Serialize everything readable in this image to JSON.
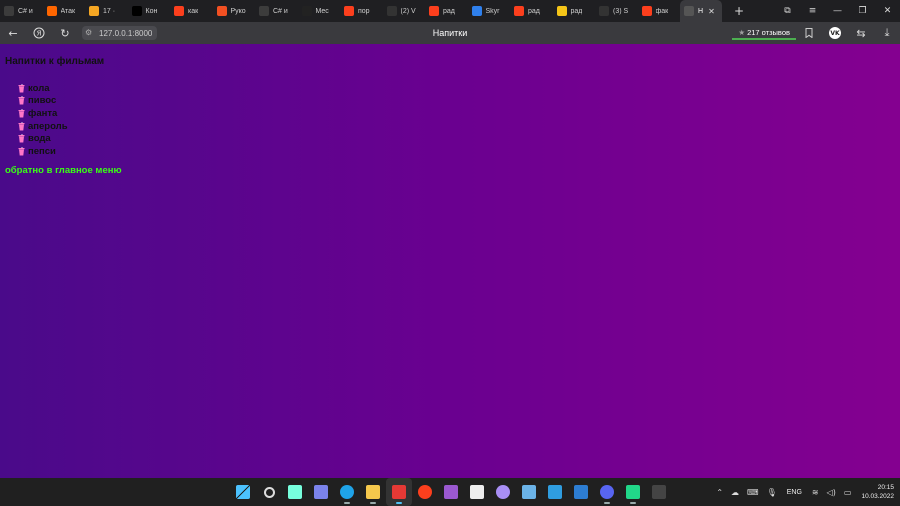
{
  "browser": {
    "tabs": [
      {
        "title": "C# и",
        "icon": "code-icon",
        "color": "#3c3c3c"
      },
      {
        "title": "Атак",
        "icon": "kinopoisk-icon",
        "color": "#f60"
      },
      {
        "title": "17 ·",
        "icon": "mail-icon",
        "color": "#f5a623"
      },
      {
        "title": "Кон",
        "icon": "tilda-icon",
        "color": "#000"
      },
      {
        "title": "как",
        "icon": "yandex-icon",
        "color": "#fc3f1d"
      },
      {
        "title": "Руко",
        "icon": "microsoft-icon",
        "color": "#f25022"
      },
      {
        "title": "C# и",
        "icon": "code-icon",
        "color": "#3c3c3c"
      },
      {
        "title": "Мес",
        "icon": "chat-icon",
        "color": "#222"
      },
      {
        "title": "пор",
        "icon": "yandex-icon",
        "color": "#fc3f1d"
      },
      {
        "title": "(2) V",
        "icon": "bolt-icon",
        "color": "#333"
      },
      {
        "title": "рад",
        "icon": "yandex-icon",
        "color": "#fc3f1d"
      },
      {
        "title": "Skyr",
        "icon": "skyeng-icon",
        "color": "#2f80ed"
      },
      {
        "title": "рад",
        "icon": "yandex-icon",
        "color": "#fc3f1d"
      },
      {
        "title": "рад",
        "icon": "image-icon",
        "color": "#f5c518"
      },
      {
        "title": "(3) S",
        "icon": "bolt-icon",
        "color": "#333"
      },
      {
        "title": "фак",
        "icon": "yandex-icon",
        "color": "#fc3f1d"
      },
      {
        "title": "Н",
        "icon": "document-icon",
        "color": "#555",
        "active": true
      }
    ],
    "new_tab": "+",
    "url": "127.0.0.1:8000",
    "page_title": "Напитки",
    "reviews_label": "217 отзывов"
  },
  "page": {
    "heading": "Напитки к фильмам",
    "drinks": [
      "кола",
      "пивос",
      "фанта",
      "апероль",
      "вода",
      "пепси"
    ],
    "back_link": "обратно в главное меню",
    "colors": {
      "gradient_start": "#4a0a8a",
      "gradient_end": "#840090",
      "link": "#39ff14",
      "cup": "#ff77c8"
    }
  },
  "taskbar": {
    "apps": [
      {
        "name": "start",
        "icon": "windows-icon",
        "color": "#4cc2ff"
      },
      {
        "name": "search",
        "icon": "search-icon",
        "color": "#ddd"
      },
      {
        "name": "task-view",
        "icon": "task-view-icon",
        "color": "#7fd"
      },
      {
        "name": "chat",
        "icon": "teams-chat-icon",
        "color": "#7b83eb"
      },
      {
        "name": "edge",
        "icon": "edge-icon",
        "color": "#1fa3e8"
      },
      {
        "name": "explorer",
        "icon": "folder-icon",
        "color": "#f5c84c"
      },
      {
        "name": "yandex-browser",
        "icon": "yandex-browser-icon",
        "color": "#e53935"
      },
      {
        "name": "yandex",
        "icon": "yandex-icon",
        "color": "#fc3f1d"
      },
      {
        "name": "visual-studio",
        "icon": "visual-studio-icon",
        "color": "#9b59d0"
      },
      {
        "name": "paint",
        "icon": "paint-icon",
        "color": "#eee"
      },
      {
        "name": "alice",
        "icon": "alice-icon",
        "color": "#a98ff5"
      },
      {
        "name": "photos",
        "icon": "photos-icon",
        "color": "#6bb3e8"
      },
      {
        "name": "phone",
        "icon": "phone-icon",
        "color": "#2f9de0"
      },
      {
        "name": "whiteboard",
        "icon": "whiteboard-icon",
        "color": "#2d7dd2"
      },
      {
        "name": "discord",
        "icon": "discord-icon",
        "color": "#5865f2"
      },
      {
        "name": "pycharm",
        "icon": "pycharm-icon",
        "color": "#21d789"
      },
      {
        "name": "terminal",
        "icon": "terminal-icon",
        "color": "#444"
      }
    ],
    "language": "ENG",
    "time": "20:15",
    "date": "10.03.2022"
  }
}
